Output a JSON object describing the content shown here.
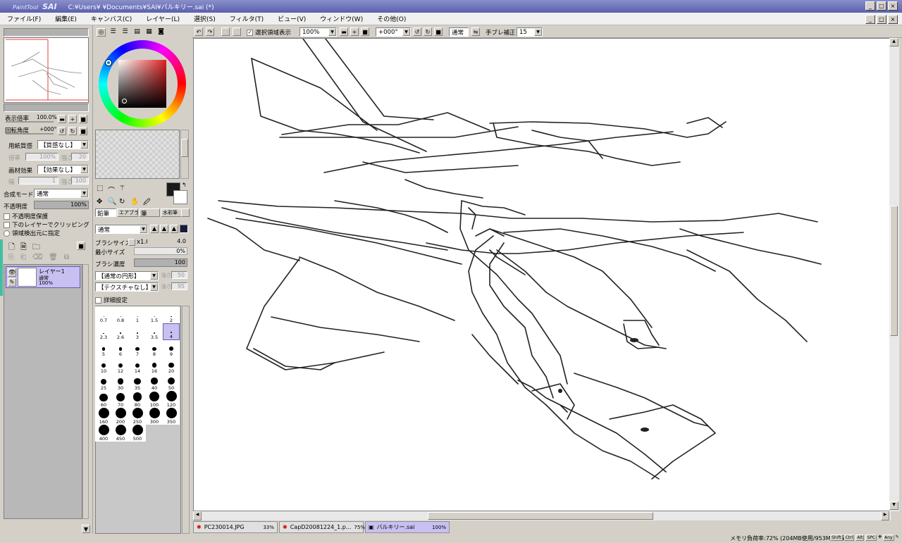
{
  "app": {
    "logo_small": "PaintTool",
    "logo": "SAI",
    "title_path": "C:¥Users¥  ¥Documents¥SAI¥バルキリー.sai (*)"
  },
  "window_buttons": [
    "_",
    "□",
    "×"
  ],
  "menu": [
    "ファイル(F)",
    "編集(E)",
    "キャンバス(C)",
    "レイヤー(L)",
    "選択(S)",
    "フィルタ(T)",
    "ビュー(V)",
    "ウィンドウ(W)",
    "その他(O)"
  ],
  "navigator": {
    "zoom_label": "表示倍率",
    "zoom_value": "100.0%",
    "rotate_label": "回転角度",
    "rotate_value": "+000°"
  },
  "paper": {
    "texture_label": "用紙質感",
    "texture_value": "【質感なし】",
    "texture_scale": "100%",
    "texture_strength": "20",
    "effect_label": "画材効果",
    "effect_value": "【効果なし】",
    "effect_width": "1",
    "effect_strength": "100",
    "scale_lbl": "倍率",
    "strength_lbl": "強さ",
    "width_lbl": "幅"
  },
  "layer_props": {
    "blend_label": "合成モード",
    "blend_value": "通常",
    "opacity_label": "不透明度",
    "opacity_value": "100%",
    "preserve_opacity": "不透明度保護",
    "clip_group": "下のレイヤーでクリッピング",
    "selection_source": "領域検出元に指定"
  },
  "layers": [
    {
      "name": "レイヤー1",
      "mode": "通常",
      "opacity": "100%"
    }
  ],
  "tools": {
    "brush_tabs": [
      "鉛筆",
      "エアブラシ",
      "筆",
      "水彩筆"
    ],
    "shape_value": "通常",
    "size_label": "ブラシサイズ",
    "size_mult": "x1.0",
    "size_value": "4.0",
    "min_size_label": "最小サイズ",
    "min_size_value": "0%",
    "density_label": "ブラシ濃度",
    "density_value": "100",
    "brush_shape": "【通常の円形】",
    "brush_shape_val": "50",
    "brush_texture": "【テクスチャなし】",
    "brush_texture_val": "95",
    "strength_lbl": "強さ",
    "detail": "詳細設定"
  },
  "brush_sizes": [
    "0.7",
    "0.8",
    "1",
    "1.5",
    "2",
    "2.3",
    "2.6",
    "3",
    "3.5",
    "4",
    "5",
    "6",
    "7",
    "8",
    "9",
    "10",
    "12",
    "14",
    "16",
    "20",
    "25",
    "30",
    "35",
    "40",
    "50",
    "60",
    "70",
    "80",
    "100",
    "120",
    "160",
    "200",
    "250",
    "300",
    "350",
    "400",
    "450",
    "500"
  ],
  "brush_selected": "4",
  "canvas_toolbar": {
    "show_selection": "選択領域表示",
    "zoom": "100%",
    "angle": "+000°",
    "mode": "通常",
    "stabilizer_label": "手ブレ補正",
    "stabilizer_value": "15"
  },
  "doc_tabs": [
    {
      "name": "PC230014.JPG",
      "zoom": "33%"
    },
    {
      "name": "CapD20081224_1.p...",
      "zoom": "75%"
    },
    {
      "name": "バルキリー.sai",
      "zoom": "100%"
    }
  ],
  "status": {
    "memory": "メモリ負荷率:72% (204MB使用/953MB確保)",
    "keys": [
      "Shift",
      "Ctrl",
      "Alt",
      "SPC",
      "Any"
    ]
  },
  "colors": {
    "title_bar": "#6a70bc",
    "selection": "#c8c0f0",
    "primary_color": "#1a1a1a",
    "secondary_color": "#ffffff"
  }
}
